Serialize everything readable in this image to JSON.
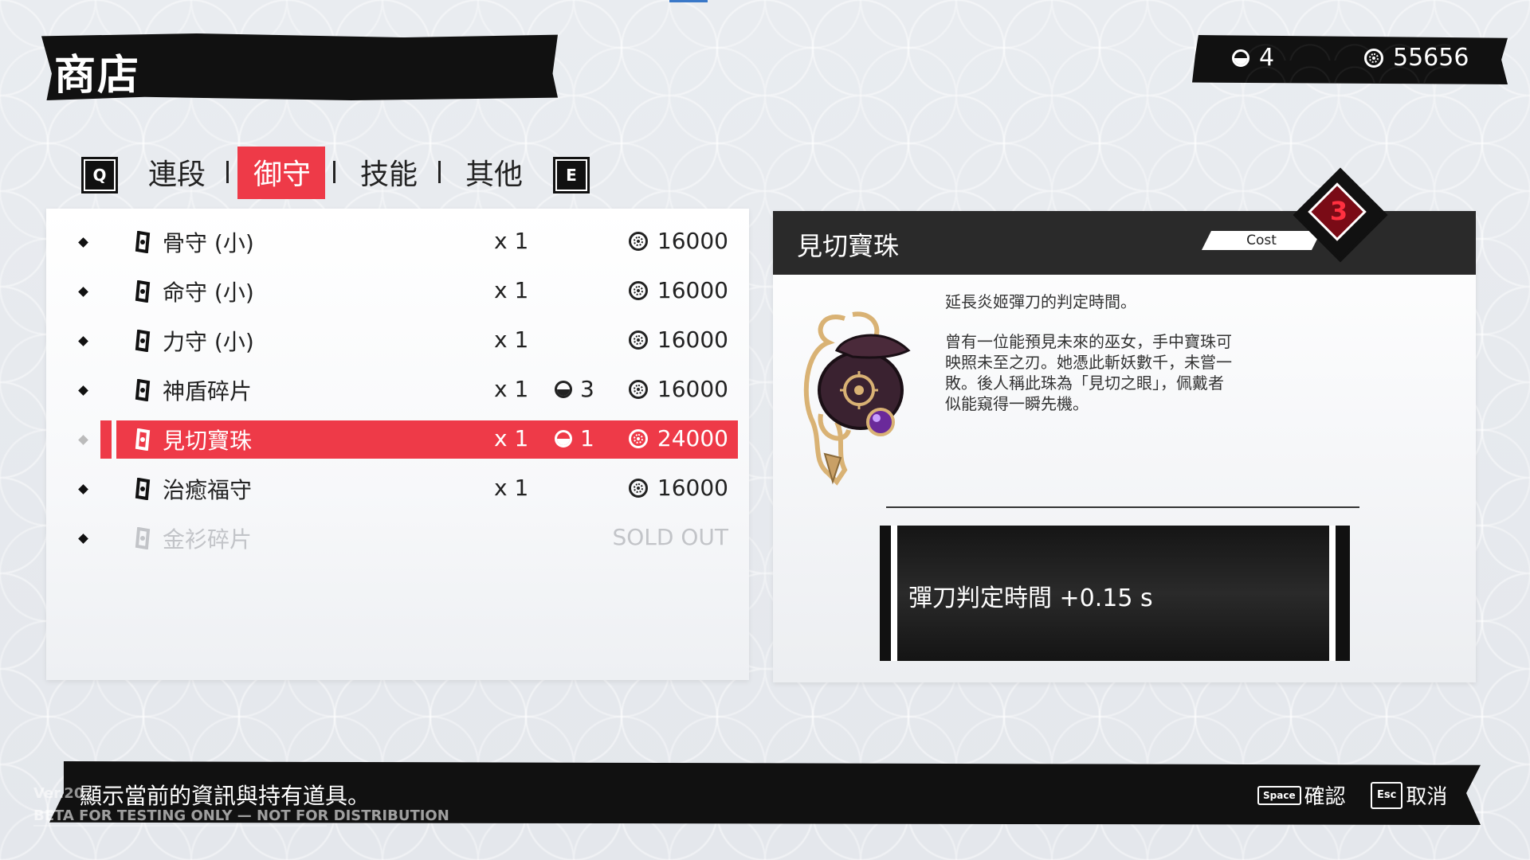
{
  "header": {
    "title": "商店"
  },
  "currency": {
    "tokens": "4",
    "coins": "55656"
  },
  "tabs": {
    "prev_key": "Q",
    "next_key": "E",
    "items": [
      {
        "label": "連段"
      },
      {
        "label": "御守"
      },
      {
        "label": "技能"
      },
      {
        "label": "其他"
      }
    ],
    "active_index": 1
  },
  "shop": {
    "items": [
      {
        "name": "骨守 (小)",
        "qty": "x 1",
        "token_cost": "",
        "price": "16000"
      },
      {
        "name": "命守 (小)",
        "qty": "x 1",
        "token_cost": "",
        "price": "16000"
      },
      {
        "name": "力守 (小)",
        "qty": "x 1",
        "token_cost": "",
        "price": "16000"
      },
      {
        "name": "神盾碎片",
        "qty": "x 1",
        "token_cost": "3",
        "price": "16000"
      },
      {
        "name": "見切寶珠",
        "qty": "x 1",
        "token_cost": "1",
        "price": "24000",
        "selected": true
      },
      {
        "name": "治癒福守",
        "qty": "x 1",
        "token_cost": "",
        "price": "16000"
      },
      {
        "name": "金衫碎片",
        "qty": "",
        "token_cost": "",
        "price": "SOLD OUT",
        "sold_out": true
      }
    ]
  },
  "detail": {
    "title": "見切寶珠",
    "cost_label": "Cost",
    "cost_value": "3",
    "description": "延長炎姬彈刀的判定時間。",
    "lore": [
      "曾有一位能預見未來的巫女，手中寶珠可",
      "映照未至之刃。她憑此斬妖數千，未嘗一",
      "敗。後人稱此珠為「見切之眼」，佩戴者",
      "似能窺得一瞬先機。"
    ],
    "effect": "彈刀判定時間 +0.15 s"
  },
  "footer": {
    "hint": "顯示當前的資訊與持有道具。",
    "version": "Ver.20",
    "beta": "BETA FOR TESTING ONLY — NOT FOR DISTRIBUTION",
    "confirm_key": "Space",
    "confirm_label": "確認",
    "cancel_key": "Esc",
    "cancel_label": "取消"
  },
  "colors": {
    "accent": "#ee3a48",
    "dark": "#111111",
    "panel": "#ffffff"
  }
}
